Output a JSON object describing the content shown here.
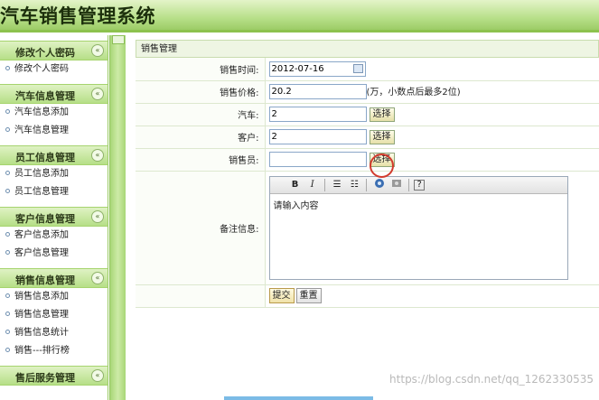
{
  "header": {
    "title": "汽车销售管理系统"
  },
  "sidebar": {
    "groups": [
      {
        "title": "修改个人密码",
        "items": [
          "修改个人密码"
        ]
      },
      {
        "title": "汽车信息管理",
        "items": [
          "汽车信息添加",
          "汽车信息管理"
        ]
      },
      {
        "title": "员工信息管理",
        "items": [
          "员工信息添加",
          "员工信息管理"
        ]
      },
      {
        "title": "客户信息管理",
        "items": [
          "客户信息添加",
          "客户信息管理"
        ]
      },
      {
        "title": "销售信息管理",
        "items": [
          "销售信息添加",
          "销售信息管理",
          "销售信息统计",
          "销售---排行榜"
        ]
      },
      {
        "title": "售后服务管理",
        "items": []
      }
    ],
    "collapse_glyph": "«"
  },
  "panel": {
    "title": "销售管理"
  },
  "form": {
    "sale_time": {
      "label": "销售时间:",
      "value": "2012-07-16"
    },
    "sale_price": {
      "label": "销售价格:",
      "value": "20.2",
      "hint": "(万，小数点后最多2位)"
    },
    "car": {
      "label": "汽车:",
      "value": "2",
      "button": "选择"
    },
    "customer": {
      "label": "客户:",
      "value": "2",
      "button": "选择"
    },
    "salesperson": {
      "label": "销售员:",
      "value": "",
      "button": "选择"
    },
    "remark": {
      "label": "备注信息:",
      "content": "请输入内容"
    },
    "submit": "提交",
    "reset": "重置"
  },
  "editor_toolbar": {
    "bold": "B",
    "italic": "I",
    "ordered_list": "☰",
    "unordered_list": "☷",
    "help": "?"
  },
  "watermark": "https://blog.csdn.net/qq_1262330535",
  "icons": [
    "collapse-icon",
    "calendar-icon",
    "bold-icon",
    "italic-icon",
    "ordered-list-icon",
    "unordered-list-icon",
    "image-icon",
    "emoticon-icon",
    "help-icon",
    "cursor-icon"
  ]
}
